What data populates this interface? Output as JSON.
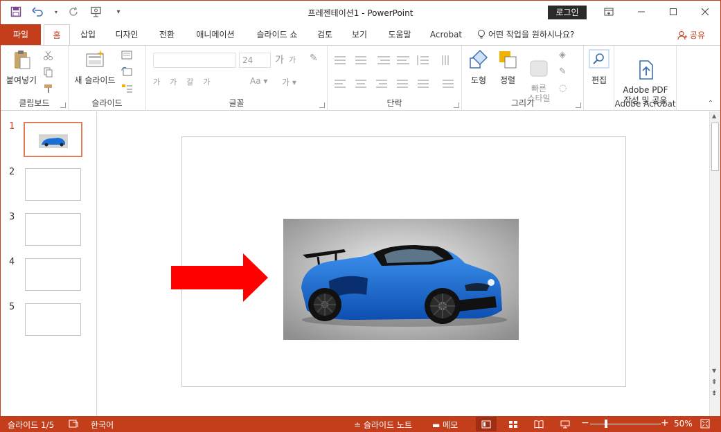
{
  "window": {
    "title": "프레젠테이션1  -  PowerPoint",
    "login_label": "로그인"
  },
  "tabs": {
    "file": "파일",
    "items": [
      "홈",
      "삽입",
      "디자인",
      "전환",
      "애니메이션",
      "슬라이드 쇼",
      "검토",
      "보기",
      "도움말",
      "Acrobat"
    ],
    "tell_me": "어떤 작업을 원하시나요?",
    "share": "공유"
  },
  "ribbon": {
    "clipboard": {
      "paste": "붙여넣기",
      "label": "클립보드"
    },
    "slides": {
      "new_slide": "새 슬라이드",
      "label": "슬라이드"
    },
    "font": {
      "label": "글꼴",
      "size": "24"
    },
    "paragraph": {
      "label": "단락"
    },
    "drawing": {
      "shapes": "도형",
      "arrange": "정렬",
      "quick_styles": "빠른\n스타일",
      "label": "그리기"
    },
    "editing": {
      "label": "편집"
    },
    "acrobat": {
      "create_pdf": "Adobe PDF\n작성 및 공유",
      "label": "Adobe Acrobat"
    }
  },
  "slides_panel": {
    "numbers": [
      "1",
      "2",
      "3",
      "4",
      "5"
    ],
    "active_index": 1
  },
  "status": {
    "slide_counter": "슬라이드 1/5",
    "language": "한국어",
    "notes": "슬라이드 노트",
    "comments": "메모",
    "zoom": "50%"
  },
  "colors": {
    "accent": "#c43e1c",
    "arrow": "#ff0000",
    "car": "#1a6fd6"
  }
}
